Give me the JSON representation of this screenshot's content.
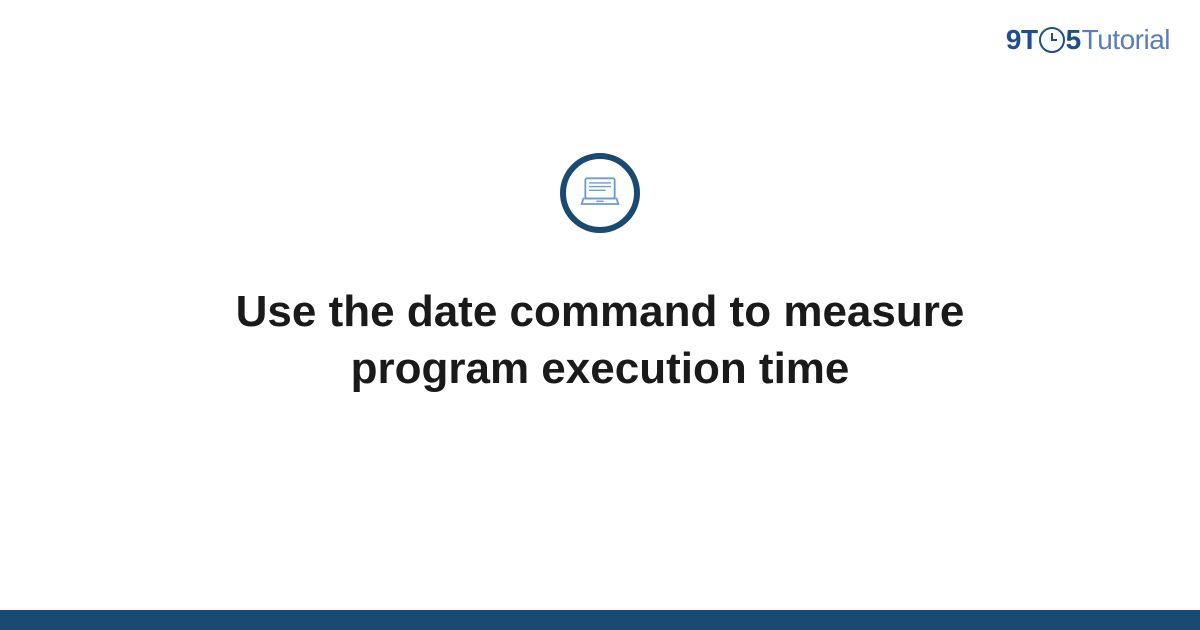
{
  "logo": {
    "prefix": "9T",
    "suffix": "5",
    "tutorial": "Tutorial"
  },
  "title": "Use the date command to measure program execution time",
  "colors": {
    "brand_dark": "#1a4971",
    "brand_light": "#5a7db8",
    "logo_color": "#1e4e8c"
  }
}
